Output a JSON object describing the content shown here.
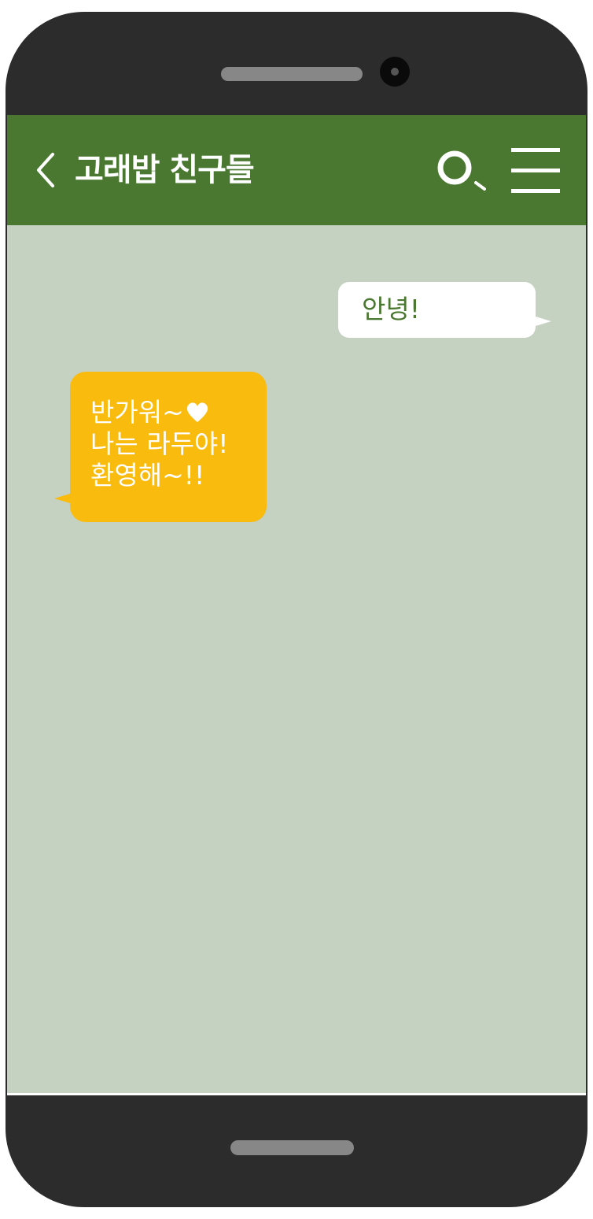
{
  "header": {
    "chat_title": "고래밥 친구들",
    "back_icon": "chevron-left-icon",
    "search_icon": "search-icon",
    "menu_icon": "hamburger-menu-icon"
  },
  "messages": [
    {
      "direction": "outgoing",
      "lines": [
        "안녕!"
      ]
    },
    {
      "direction": "incoming",
      "lines": [
        "반가워~",
        "나는 라두야!",
        "환영해~!!"
      ],
      "emoji_after_first_line": "heart-icon"
    }
  ],
  "colors": {
    "header_bg": "#4a7830",
    "chat_bg": "#c5d1c1",
    "incoming_bubble": "#f9bb0e",
    "outgoing_bubble": "#ffffff",
    "outgoing_text": "#4a7830",
    "phone_frame": "#2c2c2c"
  }
}
